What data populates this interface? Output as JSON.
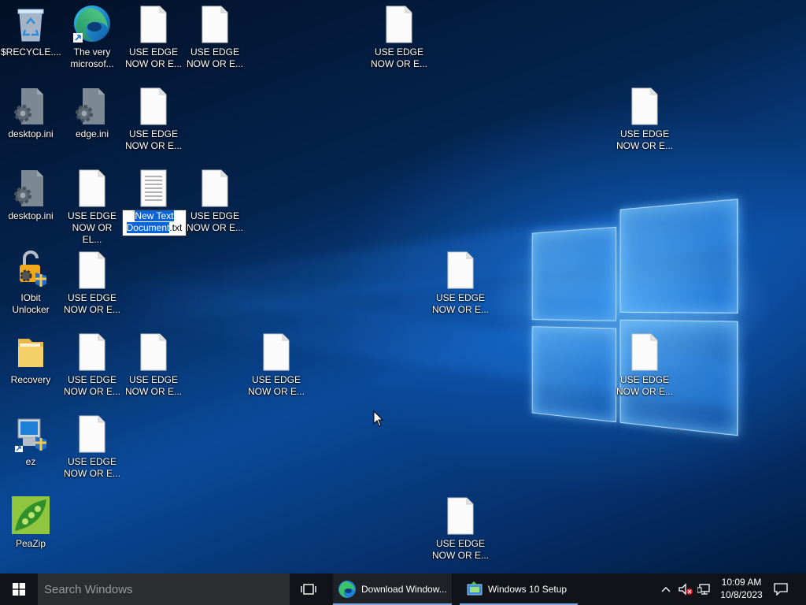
{
  "desktop": {
    "icons": {
      "recycle": "$RECYCLE....",
      "edge_shortcut": [
        "The very",
        "microsof..."
      ],
      "desktop_ini": "desktop.ini",
      "edge_ini": "edge.ini",
      "iobit": [
        "IObit",
        "Unlocker"
      ],
      "recovery": "Recovery",
      "ez": "ez",
      "peazip": "PeaZip",
      "use_edge_1": [
        "USE EDGE",
        "NOW OR E..."
      ],
      "use_edge_el": [
        "USE EDGE",
        "NOW OR EL..."
      ]
    },
    "rename": {
      "selected": [
        "New Text",
        "Document"
      ],
      "ext": ".txt"
    }
  },
  "taskbar": {
    "search_placeholder": "Search Windows",
    "apps": [
      {
        "label": "Download Window...",
        "icon": "edge-icon"
      },
      {
        "label": "Windows 10 Setup",
        "icon": "setup-icon"
      }
    ],
    "time": "10:09 AM",
    "date": "10/8/2023"
  },
  "colors": {
    "accent": "#0a64d8",
    "taskbar": "#111318"
  }
}
